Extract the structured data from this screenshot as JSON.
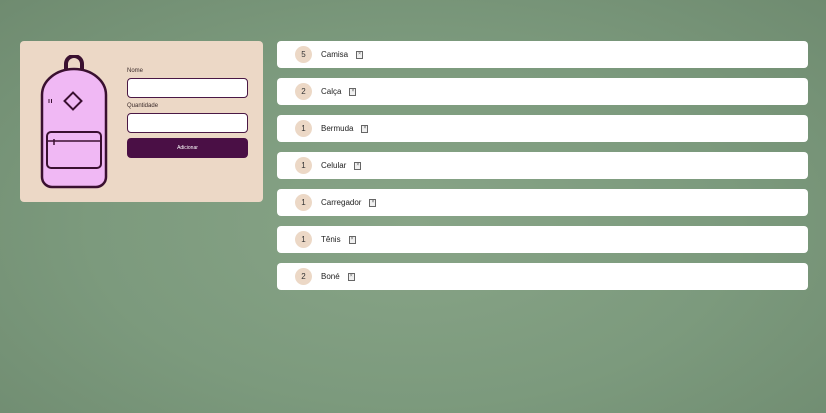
{
  "form": {
    "name_label": "Nome",
    "name_value": "",
    "quantity_label": "Quantidade",
    "quantity_value": "",
    "submit_label": "Adicionar"
  },
  "items": [
    {
      "qty": "5",
      "name": "Camisa",
      "delete_icon": "x-icon"
    },
    {
      "qty": "2",
      "name": "Calça",
      "delete_icon": "x-icon"
    },
    {
      "qty": "1",
      "name": "Bermuda",
      "delete_icon": "x-icon"
    },
    {
      "qty": "1",
      "name": "Celular",
      "delete_icon": "x-icon"
    },
    {
      "qty": "1",
      "name": "Carregador",
      "delete_icon": "x-icon"
    },
    {
      "qty": "1",
      "name": "Tênis",
      "delete_icon": "x-icon"
    },
    {
      "qty": "2",
      "name": "Boné",
      "delete_icon": "x-icon"
    }
  ],
  "colors": {
    "background": "#829f83",
    "card": "#ecd8c6",
    "accent": "#4a0f45",
    "backpack": "#f0b8f4"
  }
}
